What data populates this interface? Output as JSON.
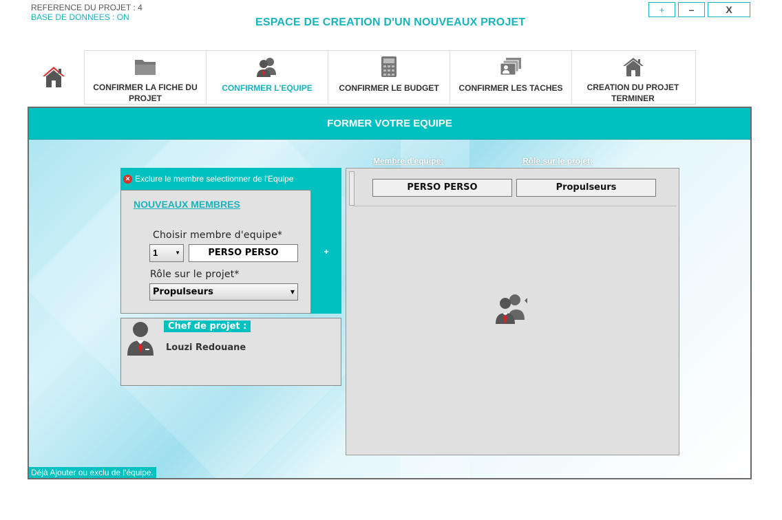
{
  "header": {
    "reference": "REFERENCE DU PROJET : 4",
    "database": "BASE DE DONNEES : ON",
    "title": "ESPACE DE CREATION D'UN NOUVEAUX PROJET"
  },
  "window_controls": {
    "plus": "+",
    "minimize": "–",
    "close": "X"
  },
  "steps": [
    {
      "label": "CONFIRMER LA FICHE DU PROJET",
      "icon": "folder-icon",
      "active": false
    },
    {
      "label": "CONFIRMER L'EQUIPE",
      "icon": "team-icon",
      "active": true
    },
    {
      "label": "CONFIRMER LE BUDGET",
      "icon": "calculator-icon",
      "active": false
    },
    {
      "label": "CONFIRMER LES TACHES",
      "icon": "cards-icon",
      "active": false
    },
    {
      "label": "CREATION DU PROJET TERMINER",
      "icon": "house-icon",
      "active": false
    }
  ],
  "frame": {
    "title": "FORMER VOTRE EQUIPE",
    "exclude_label": "Exclure le membre selectionner de l'Equipe",
    "new_members": {
      "link": "NOUVEAUX MEMBRES",
      "member_label": "Choisir membre d'equipe*",
      "member_number": "1",
      "member_name": "PERSO PERSO",
      "role_label": "Rôle sur le projet*",
      "role_value": "Propulseurs",
      "add_label": "+"
    },
    "chef": {
      "label": "Chef de projet :",
      "name": "Louzi Redouane"
    },
    "team_columns": {
      "member": "Membre d'equipe:",
      "role": "Rôle sur le projet:"
    },
    "team_rows": [
      {
        "member": "PERSO PERSO",
        "role": "Propulseurs"
      }
    ],
    "status": "Déjà Ajouter ou exclu de l'équipe."
  },
  "colors": {
    "accent": "#00c0c0",
    "text_accent": "#17b3bf",
    "danger": "#d9312b",
    "tie": "#e02020"
  }
}
